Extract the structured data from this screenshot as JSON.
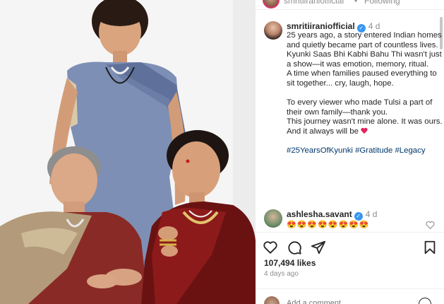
{
  "top_bar": {
    "handle": "smritiiraniofficial",
    "separator": "•",
    "follow_label": "Following"
  },
  "post": {
    "username": "smritiiraniofficial",
    "verified": true,
    "time": "4 d",
    "caption_lines": [
      "25 years ago, a story entered Indian homes and quietly became part of countless lives.",
      "Kyunki Saas Bhi Kabhi Bahu Thi wasn't just a show—it was emotion, memory, ritual.",
      "A time when families paused everything to sit together... cry, laugh, hope.",
      "",
      "To every viewer who made Tulsi a part of their own family—thank you.",
      "This journey wasn't mine alone. It was ours.",
      "And it always will be"
    ],
    "hashtags": "#25YearsOfKyunki #Gratitude #Legacy"
  },
  "comment": {
    "username": "ashlesha.savant",
    "verified": true,
    "time": "4 d",
    "text": "😍😍😍😍😍😍😍😍"
  },
  "actions": {
    "icons": [
      "heart-icon",
      "comment-icon",
      "share-icon",
      "bookmark-icon"
    ]
  },
  "likes": "107,494 likes",
  "timestamp": "4 days ago",
  "add_comment": {
    "placeholder": "Add a comment..."
  },
  "colors": {
    "verified_blue": "#3897f0",
    "heart_red": "#e0245e",
    "hashtag_blue": "#00376b",
    "muted_gray": "#8e8e8e"
  }
}
